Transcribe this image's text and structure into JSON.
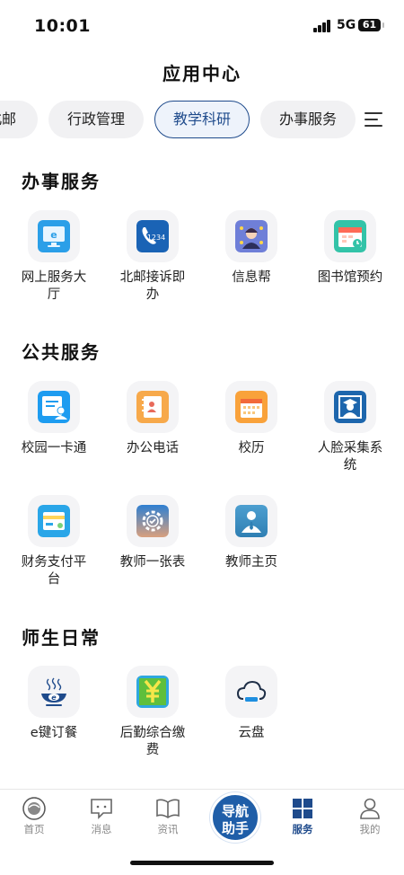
{
  "status": {
    "time": "10:01",
    "network": "5G",
    "battery": "61"
  },
  "title": "应用中心",
  "tabs": [
    "北邮",
    "行政管理",
    "教学科研",
    "办事服务"
  ],
  "active_tab": "教学科研",
  "sections": [
    {
      "title": "办事服务",
      "apps": [
        "网上服务大厅",
        "北邮接诉即办",
        "信息帮",
        "图书馆预约"
      ]
    },
    {
      "title": "公共服务",
      "apps": [
        "校园一卡通",
        "办公电话",
        "校历",
        "人脸采集系统",
        "财务支付平台",
        "教师一张表",
        "教师主页"
      ]
    },
    {
      "title": "师生日常",
      "apps": [
        "e键订餐",
        "后勤综合缴费",
        "云盘"
      ]
    }
  ],
  "icons": {
    "online-service": "monitor-e-icon",
    "complaint": "phone-1234-icon",
    "info-help": "support-agent-icon",
    "library": "calendar-booking-icon",
    "campus-card": "id-card-icon",
    "office-phone": "contact-book-icon",
    "calendar": "calendar-icon",
    "face": "graduate-portrait-icon",
    "finance": "payment-card-icon",
    "teacher-table": "gear-check-icon",
    "teacher-home": "person-tie-icon",
    "e-order": "steaming-bowl-e-icon",
    "logistics": "yuan-icon",
    "cloud": "cloud-icon"
  },
  "nav": {
    "items": [
      "首页",
      "消息",
      "资讯",
      "服务",
      "我的"
    ],
    "center_line1": "导航",
    "center_line2": "助手",
    "active": "服务"
  },
  "colors": {
    "accent": "#1f4b8c",
    "tab_bg": "#f1f1f3",
    "tile_bg": "#f4f4f6"
  }
}
